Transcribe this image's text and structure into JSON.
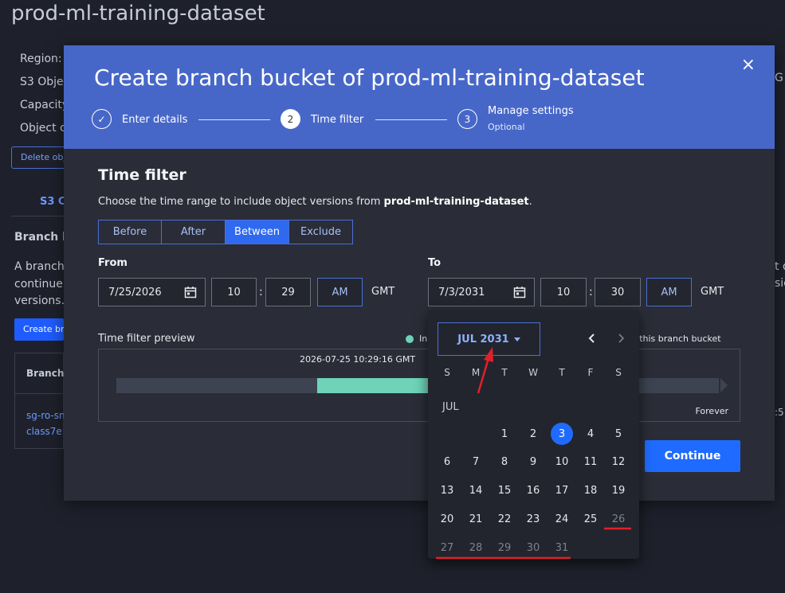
{
  "background": {
    "title": "prod-ml-training-dataset",
    "info_lines": [
      "Region:",
      "S3 Objec",
      "Capacity",
      "Object c"
    ],
    "delete_button": "Delete obj",
    "tab": "S3 Co",
    "branch_heading": "Branch b",
    "paragraph_lines": [
      "A branch",
      "continue",
      "versions."
    ],
    "create_button": "Create br",
    "table_header": "Branch b",
    "table_cell_lines": [
      "sg-ro-sn",
      "class7e"
    ],
    "right_edge": [
      "G",
      "t d",
      "sic",
      ":5"
    ]
  },
  "modal": {
    "title": "Create branch bucket of prod-ml-training-dataset",
    "close_glyph": "×",
    "steps": [
      {
        "number": "✓",
        "label": "Enter details",
        "sub": ""
      },
      {
        "number": "2",
        "label": "Time filter",
        "sub": ""
      },
      {
        "number": "3",
        "label": "Manage settings",
        "sub": "Optional"
      }
    ],
    "section_title": "Time filter",
    "desc_prefix": "Choose the time range to include object versions from ",
    "desc_bucket": "prod-ml-training-dataset",
    "desc_suffix": ".",
    "segments": [
      "Before",
      "After",
      "Between",
      "Exclude"
    ],
    "active_segment": "Between",
    "from": {
      "label": "From",
      "date": "7/25/2026",
      "hour": "10",
      "minute": "29",
      "ampm": "AM",
      "tz": "GMT",
      "colon": ":"
    },
    "to": {
      "label": "To",
      "date": "7/3/2031",
      "hour": "10",
      "minute": "30",
      "ampm": "AM",
      "tz": "GMT",
      "colon": ":"
    },
    "preview": {
      "label": "Time filter preview",
      "legend_included": "In",
      "legend_excluded": "m this branch bucket",
      "start_timestamp": "2026-07-25 10:29:16 GMT",
      "end_label": "Forever",
      "included_start_fraction": 0.333,
      "included_end_fraction": 0.52
    },
    "continue_button": "Continue"
  },
  "calendar": {
    "month_button": "JUL 2031",
    "weekdays": [
      "S",
      "M",
      "T",
      "W",
      "T",
      "F",
      "S"
    ],
    "month_label": "JUL",
    "first_weekday": 2,
    "days_in_month": 31,
    "selected_day": 3,
    "disabled_from_day": 26,
    "colors": {
      "accent": "#1f6bff",
      "annotation": "#e0202a"
    }
  }
}
